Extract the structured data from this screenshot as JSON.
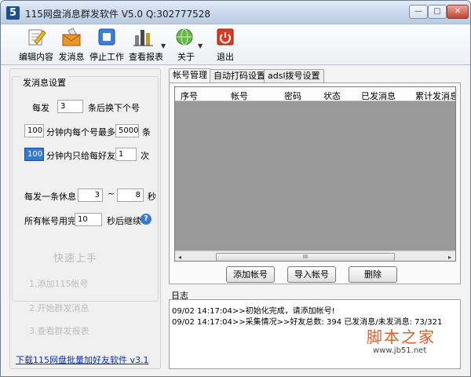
{
  "window": {
    "app_icon": "5",
    "title": "115网盘消息群发软件 V5.0  Q:302777528",
    "minimize_glyph": "—",
    "maximize_glyph": "□",
    "close_glyph": "✕"
  },
  "toolbar": {
    "edit": "编辑内容",
    "send": "发消息",
    "stop": "停止工作",
    "report": "查看报表",
    "about": "关于",
    "exit": "退出"
  },
  "settings": {
    "legend": "发消息设置",
    "per_send_prefix": "每发",
    "per_send_value": "3",
    "per_send_suffix": "条后换下个号",
    "minutes_value": "100",
    "minutes_text": "分钟内每个号最多发",
    "max_value": "5000",
    "max_unit": "条",
    "friend_minutes_value": "100",
    "friend_text": "分钟内只给每好友发",
    "friend_times_value": "1",
    "friend_times_unit": "次",
    "rest_label": "每发一条休息",
    "rest_min": "3",
    "rest_dash": "~",
    "rest_max": "8",
    "rest_unit": "秒",
    "resume_label": "所有帐号用完",
    "resume_value": "10",
    "resume_suffix": "秒后继续",
    "help_glyph": "?"
  },
  "quickstart": {
    "title": "快速上手",
    "step1": "1.添加115帐号",
    "step2": "2.开始群发消息",
    "step3": "3.查看群发报表"
  },
  "download_link": "下载115网盘批量加好友软件 v3.1",
  "tabs": [
    "帐号管理",
    "自动打码设置",
    "adsl拨号设置"
  ],
  "grid": {
    "columns": [
      "序号",
      "帐号",
      "密码",
      "状态",
      "已发消息",
      "累计发消息"
    ],
    "rows": [],
    "scroll_left": "◂",
    "scroll_right": "▸",
    "scroll_grip": "III"
  },
  "buttons": {
    "add": "添加帐号",
    "import": "导入帐号",
    "delete": "删除"
  },
  "log": {
    "label": "日志",
    "lines": [
      "09/02 14:17:04>>初始化完成，请添加帐号!",
      "09/02 14:17:04>>采集情况>>好友总数: 394 已发消息/未发消息: 73/321"
    ]
  },
  "watermark": {
    "text": "脚本之家",
    "url": "www.jb51.net"
  },
  "colors": {
    "link": "#0a2fb0",
    "watermark": "#e15b2b",
    "grid_background": "#9a9a9a"
  }
}
